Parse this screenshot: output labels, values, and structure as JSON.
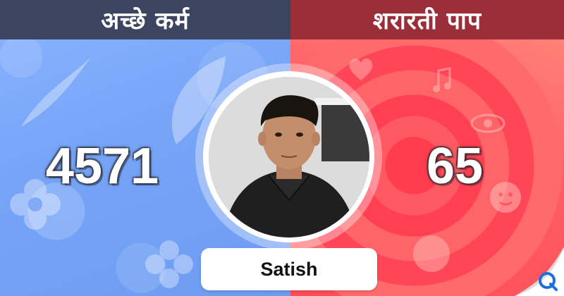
{
  "headers": {
    "left": "अच्छे कर्म",
    "right": "शरारती पाप"
  },
  "scores": {
    "good_deeds": "4571",
    "naughty_sins": "65"
  },
  "profile": {
    "name": "Satish"
  },
  "colors": {
    "left_header": "#3c4560",
    "right_header": "#9b2f39",
    "left_panel": "#7aa8f8",
    "right_panel": "#ff5a62"
  },
  "icons": {
    "logo": "q-logo-icon"
  }
}
